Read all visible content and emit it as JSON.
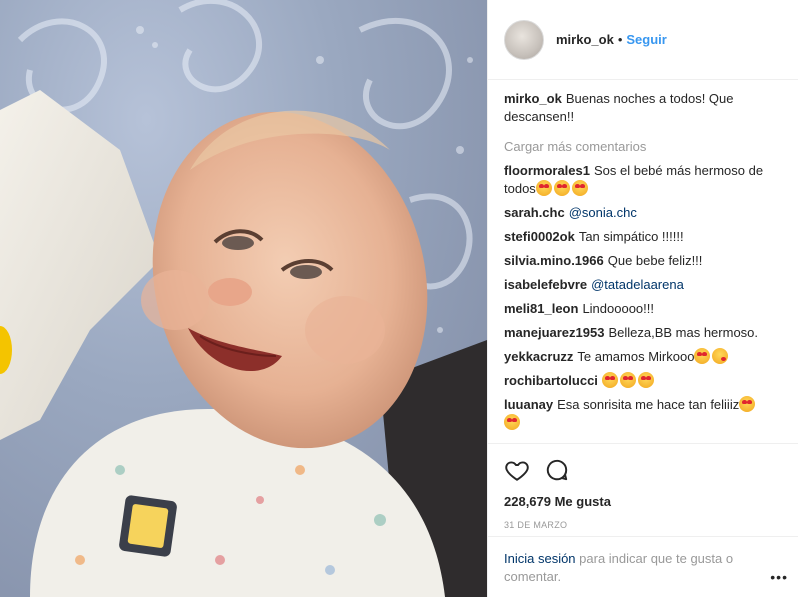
{
  "post": {
    "image_alt": "Smiling baby lying on a blanket",
    "author": "mirko_ok",
    "follow_label": "Seguir",
    "dot": "•",
    "caption_user": "mirko_ok",
    "caption_text": "Buenas noches a todos! Que descansen!!",
    "load_more_label": "Cargar más comentarios",
    "likes": "228,679 Me gusta",
    "date": "31 DE MARZO",
    "login_link": "Inicia sesión",
    "login_text": " para indicar que te gusta o comentar.",
    "more_label": "•••"
  },
  "comments": [
    {
      "user": "floormorales1",
      "text": "Sos el bebé más hermoso de todos",
      "emojis": [
        "heart-eyes",
        "heart-eyes",
        "heart-eyes"
      ]
    },
    {
      "user": "sarah.chc",
      "text": "",
      "mention": "@sonia.chc"
    },
    {
      "user": "stefi0002ok",
      "text": "Tan simpático !!!!!!"
    },
    {
      "user": "silvia.mino.1966",
      "text": "Que bebe feliz!!!"
    },
    {
      "user": "isabelefebvre",
      "text": "",
      "mention": "@tatadelaarena"
    },
    {
      "user": "meli81_leon",
      "text": "Lindooooo!!!"
    },
    {
      "user": "manejuarez1953",
      "text": "Belleza,BB mas hermoso."
    },
    {
      "user": "yekkacruzz",
      "text": "Te amamos Mirkooo",
      "emojis": [
        "heart-eyes",
        "kiss"
      ]
    },
    {
      "user": "rochibartolucci",
      "text": "",
      "emojis": [
        "heart-eyes",
        "heart-eyes",
        "heart-eyes"
      ]
    },
    {
      "user": "luuanay",
      "text": "Esa sonrisita me hace tan feliiiz",
      "emojis": [
        "heart-eyes",
        "heart-eyes"
      ]
    }
  ],
  "icons": {
    "like": "heart-outline-icon",
    "comment": "comment-bubble-icon"
  },
  "colors": {
    "link_blue": "#3897f0",
    "mention_blue": "#003569",
    "muted": "#999999",
    "border": "#efefef"
  }
}
